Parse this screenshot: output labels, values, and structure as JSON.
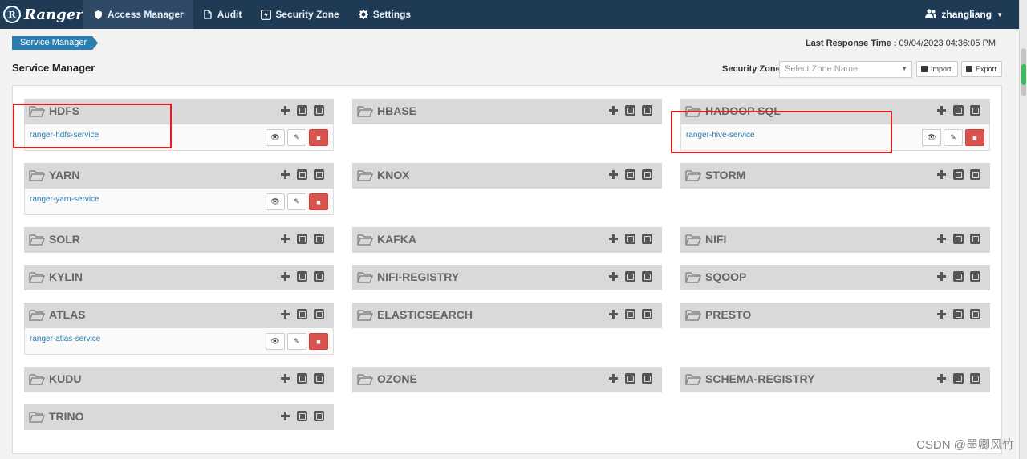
{
  "navbar": {
    "brand": "Ranger",
    "brand_logo": "R",
    "items": [
      {
        "label": "Access Manager",
        "icon": "shield-icon"
      },
      {
        "label": "Audit",
        "icon": "file-icon"
      },
      {
        "label": "Security Zone",
        "icon": "lightning-icon"
      },
      {
        "label": "Settings",
        "icon": "gear-icon"
      }
    ],
    "user": "zhangliang"
  },
  "breadcrumb": "Service Manager",
  "last_response": {
    "label": "Last Response Time :",
    "value": "09/04/2023 04:36:05 PM"
  },
  "page_title": "Service Manager",
  "zone": {
    "label": "Security Zone:",
    "placeholder": "Select Zone Name"
  },
  "import_label": "Import",
  "export_label": "Export",
  "services": [
    {
      "name": "HDFS",
      "instance": "ranger-hdfs-service"
    },
    {
      "name": "HBASE"
    },
    {
      "name": "HADOOP SQL",
      "instance": "ranger-hive-service"
    },
    {
      "name": "YARN",
      "instance": "ranger-yarn-service"
    },
    {
      "name": "KNOX"
    },
    {
      "name": "STORM"
    },
    {
      "name": "SOLR"
    },
    {
      "name": "KAFKA"
    },
    {
      "name": "NIFI"
    },
    {
      "name": "KYLIN"
    },
    {
      "name": "NIFI-REGISTRY"
    },
    {
      "name": "SQOOP"
    },
    {
      "name": "ATLAS",
      "instance": "ranger-atlas-service"
    },
    {
      "name": "ELASTICSEARCH"
    },
    {
      "name": "PRESTO"
    },
    {
      "name": "KUDU"
    },
    {
      "name": "OZONE"
    },
    {
      "name": "SCHEMA-REGISTRY"
    },
    {
      "name": "TRINO"
    }
  ],
  "watermark": "CSDN @墨卿风竹",
  "colors": {
    "navbar": "#1f3a55",
    "breadcrumb": "#2b7fb0",
    "delete": "#d9534f",
    "highlight": "#e02020"
  }
}
